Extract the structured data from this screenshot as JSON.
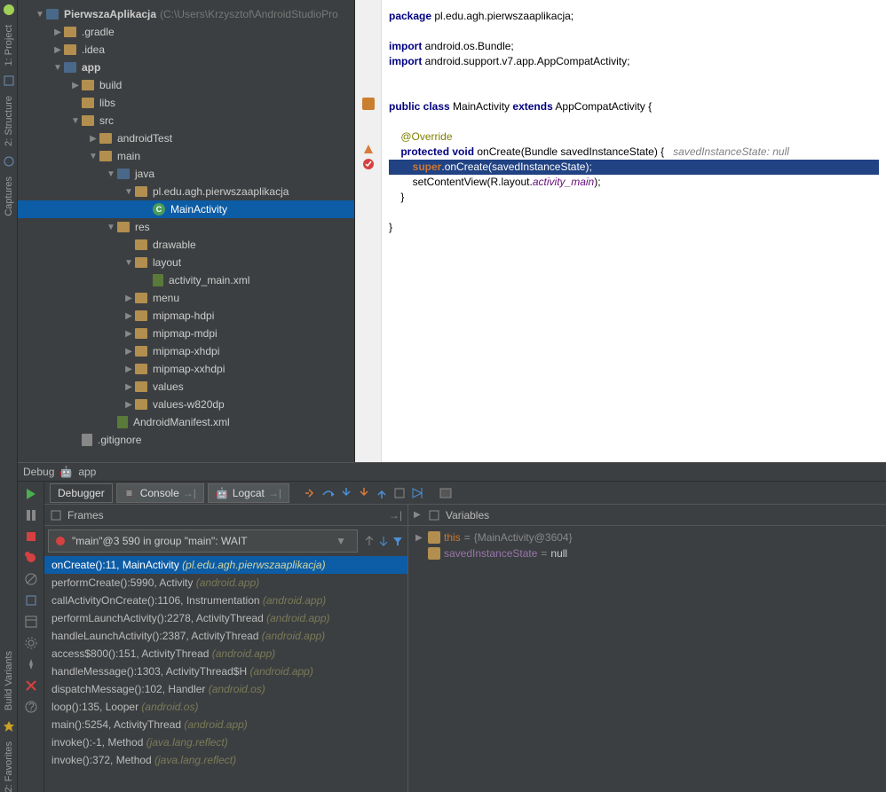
{
  "left_rail": {
    "project": "1: Project",
    "structure": "2: Structure",
    "captures": "Captures",
    "build_variants": "Build Variants",
    "favorites": "2: Favorites"
  },
  "project": {
    "root": "PierwszaAplikacja",
    "root_path": "(C:\\Users\\Krzysztof\\AndroidStudioPro",
    "nodes": {
      "gradle": ".gradle",
      "idea": ".idea",
      "app": "app",
      "build": "build",
      "libs": "libs",
      "src": "src",
      "androidTest": "androidTest",
      "main": "main",
      "java": "java",
      "package": "pl.edu.agh.pierwszaaplikacja",
      "mainActivity": "MainActivity",
      "res": "res",
      "drawable": "drawable",
      "layout": "layout",
      "activity_main_xml": "activity_main.xml",
      "menu": "menu",
      "mipmap_hdpi": "mipmap-hdpi",
      "mipmap_mdpi": "mipmap-mdpi",
      "mipmap_xhdpi": "mipmap-xhdpi",
      "mipmap_xxhdpi": "mipmap-xxhdpi",
      "values": "values",
      "values_w820dp": "values-w820dp",
      "manifest": "AndroidManifest.xml",
      "gitignore": ".gitignore"
    }
  },
  "code": {
    "l1": "package pl.edu.agh.pierwszaaplikacja;",
    "l3": "import android.os.Bundle;",
    "l4": "import android.support.v7.app.AppCompatActivity;",
    "l7a": "public class ",
    "l7b": "MainActivity ",
    "l7c": "extends ",
    "l7d": "AppCompatActivity {",
    "l9": "    @Override",
    "l10a": "    protected void ",
    "l10b": "onCreate(Bundle savedInstanceState) {   ",
    "l10c": "savedInstanceState: null",
    "l11": "        super.onCreate(savedInstanceState);",
    "l12a": "        setContentView(R.layout.",
    "l12b": "activity_main",
    "l12c": ");",
    "l13": "    }",
    "l15": "}"
  },
  "debug": {
    "title": "Debug",
    "app": "app",
    "tabs": {
      "debugger": "Debugger",
      "console": "Console",
      "logcat": "Logcat"
    },
    "frames_title": "Frames",
    "variables_title": "Variables",
    "thread": "\"main\"@3 590 in group \"main\": WAIT",
    "frames": [
      {
        "m": "onCreate():11, MainActivity ",
        "p": "(pl.edu.agh.pierwszaaplikacja)",
        "sel": true
      },
      {
        "m": "performCreate():5990, Activity ",
        "p": "(android.app)"
      },
      {
        "m": "callActivityOnCreate():1106, Instrumentation ",
        "p": "(android.app)"
      },
      {
        "m": "performLaunchActivity():2278, ActivityThread ",
        "p": "(android.app)"
      },
      {
        "m": "handleLaunchActivity():2387, ActivityThread ",
        "p": "(android.app)"
      },
      {
        "m": "access$800():151, ActivityThread ",
        "p": "(android.app)"
      },
      {
        "m": "handleMessage():1303, ActivityThread$H ",
        "p": "(android.app)"
      },
      {
        "m": "dispatchMessage():102, Handler ",
        "p": "(android.os)"
      },
      {
        "m": "loop():135, Looper ",
        "p": "(android.os)"
      },
      {
        "m": "main():5254, ActivityThread ",
        "p": "(android.app)"
      },
      {
        "m": "invoke():-1, Method ",
        "p": "(java.lang.reflect)"
      },
      {
        "m": "invoke():372, Method ",
        "p": "(java.lang.reflect)"
      }
    ],
    "vars": {
      "this_name": "this",
      "this_eq": " = ",
      "this_val": "{MainActivity@3604}",
      "sis_name": "savedInstanceState",
      "sis_eq": " = ",
      "sis_val": "null"
    }
  }
}
